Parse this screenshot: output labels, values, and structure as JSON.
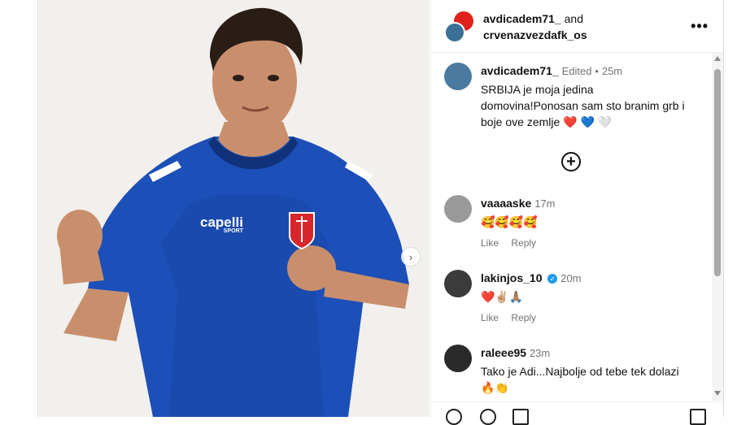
{
  "header": {
    "user1": "avdicadem71_",
    "and_text": "and",
    "user2": "crvenazvezdafk_os",
    "more_icon": "more-horizontal-icon"
  },
  "caption": {
    "user": "avdicadem71_",
    "edited": "Edited",
    "dot": "•",
    "time": "25m",
    "text": "SRBIJA je moja jedina domovina!Ponosan sam sto branim grb i boje ove zemlje",
    "emojis": "❤️ 💙 🤍"
  },
  "add_icon": "plus-circle-icon",
  "comments": [
    {
      "user": "vaaaaske",
      "time": "17m",
      "text": "🥰🥰🥰🥰",
      "like": "Like",
      "reply": "Reply"
    },
    {
      "user": "lakinjos_10",
      "verified": true,
      "time": "20m",
      "text": "❤️✌🏼🙏🏽",
      "like": "Like",
      "reply": "Reply"
    },
    {
      "user": "raleee95",
      "time": "23m",
      "text": "Tako je Adi...Najbolje od tebe tek dolazi 🔥👏"
    }
  ],
  "photo": {
    "jersey_brand": "capelli",
    "jersey_sub": "SPORT",
    "jersey_color": "#1d4fb8"
  }
}
